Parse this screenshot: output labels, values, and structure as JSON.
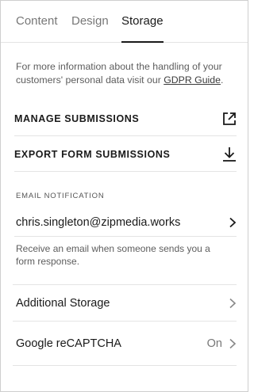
{
  "tabs": [
    {
      "label": "Content",
      "active": false
    },
    {
      "label": "Design",
      "active": false
    },
    {
      "label": "Storage",
      "active": true
    }
  ],
  "info": {
    "text": "For more information about the handling of your customers' personal data visit our ",
    "link": "GDPR Guide",
    "suffix": "."
  },
  "actions": {
    "manage_label": "MANAGE SUBMISSIONS",
    "manage_icon": "external-link-icon",
    "export_label": "EXPORT FORM SUBMISSIONS",
    "export_icon": "download-icon"
  },
  "email_notification": {
    "section_label": "EMAIL NOTIFICATION",
    "email": "chris.singleton@zipmedia.works",
    "description": "Receive an email when someone sends you a form response."
  },
  "additional_storage": {
    "label": "Additional Storage"
  },
  "recaptcha": {
    "label": "Google reCAPTCHA",
    "value": "On"
  },
  "colors": {
    "text": "#1a1a1a",
    "muted": "#777777",
    "divider": "#e4e4e4"
  }
}
